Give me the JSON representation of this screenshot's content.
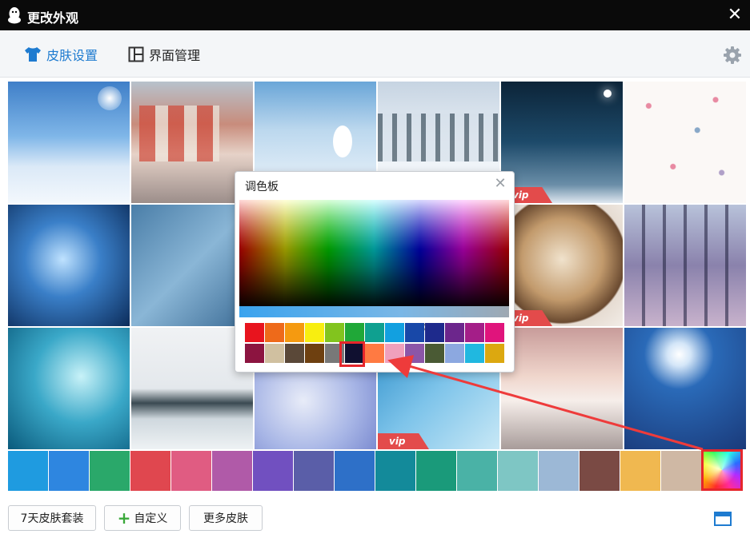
{
  "window": {
    "title": "更改外观",
    "close_label": "✕"
  },
  "tabs": [
    {
      "label": "皮肤设置",
      "icon": "tshirt-icon",
      "active": true
    },
    {
      "label": "界面管理",
      "icon": "layout-icon",
      "active": false
    }
  ],
  "skins": [
    {
      "name": "sky-clouds",
      "vip": false
    },
    {
      "name": "street-houses",
      "vip": false
    },
    {
      "name": "snowman-forest",
      "vip": false
    },
    {
      "name": "snowy-pines",
      "vip": false
    },
    {
      "name": "night-streetlamp",
      "vip": true
    },
    {
      "name": "pink-snowflakes",
      "vip": false
    },
    {
      "name": "blue-snowflake",
      "vip": false
    },
    {
      "name": "merry-christmas-frost",
      "vip": false
    },
    {
      "name": "winter-hidden-1",
      "vip": false
    },
    {
      "name": "winter-hidden-2",
      "vip": false
    },
    {
      "name": "latte-snowflake",
      "vip": true
    },
    {
      "name": "purple-forest",
      "vip": false
    },
    {
      "name": "cyan-branches",
      "vip": false
    },
    {
      "name": "frozen-lake-birds",
      "vip": false
    },
    {
      "name": "bird-bokeh",
      "vip": false
    },
    {
      "name": "blue-feather",
      "vip": true
    },
    {
      "name": "snowy-bridge",
      "vip": false
    },
    {
      "name": "moon-reindeer",
      "vip": false
    }
  ],
  "vip_label": "vip",
  "theme_colors": [
    "#1f9be0",
    "#2e86e0",
    "#2aa86a",
    "#e0474f",
    "#e05c82",
    "#b05aa8",
    "#7150c0",
    "#5a5ea8",
    "#2e70c8",
    "#138a9a",
    "#1a9a7a",
    "#4ab2a6",
    "#7ec6c4",
    "#9cb8d6",
    "#7a4a44",
    "#f0b850",
    "#cfb8a4"
  ],
  "custom_color_icon": "rainbow-icon",
  "palette": {
    "title": "调色板",
    "close_label": "✕",
    "row1": [
      "#e8141e",
      "#ee6a1a",
      "#f59a10",
      "#f8ee10",
      "#82c41e",
      "#20a838",
      "#0fa090",
      "#12a0e0",
      "#1848a8",
      "#1e2a8c",
      "#6c268c",
      "#a41e88",
      "#e0147c"
    ],
    "row2": [
      "#8c1440",
      "#d0c0a0",
      "#5a4838",
      "#6e4010",
      "#787878",
      "#101030",
      "#ff7a42",
      "#f0a0bc",
      "#8c56a8",
      "#4a5a34",
      "#8ca8e0",
      "#20b8e0",
      "#dca810"
    ],
    "selected_index": 5
  },
  "buttons": {
    "seven_day": "7天皮肤套装",
    "custom": "自定义",
    "more": "更多皮肤"
  }
}
